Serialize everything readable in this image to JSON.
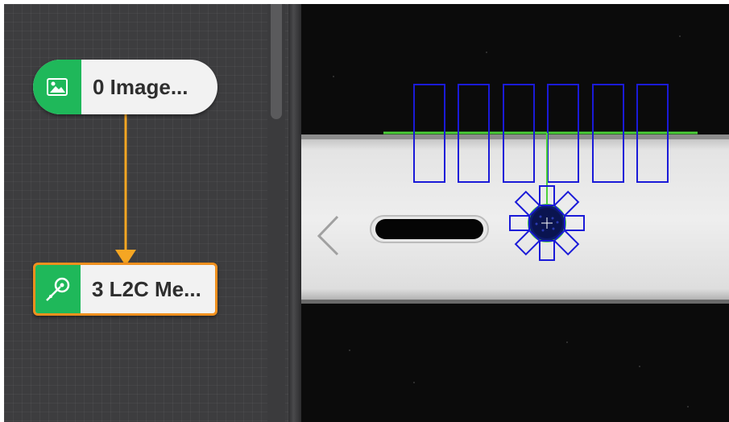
{
  "flow": {
    "nodes": [
      {
        "label": "0 Image...",
        "icon": "image-icon"
      },
      {
        "label": "3 L2C Me...",
        "icon": "line-circle-measure-icon"
      }
    ]
  },
  "colors": {
    "node_accent": "#1fb85a",
    "selected_border": "#f0901e",
    "connector": "#f5a623",
    "roi_boxes": "#1a1ad8",
    "fit_line": "#4cd13a"
  },
  "viewer": {
    "roi_box_count": 6,
    "circle_roi_count": 8
  }
}
